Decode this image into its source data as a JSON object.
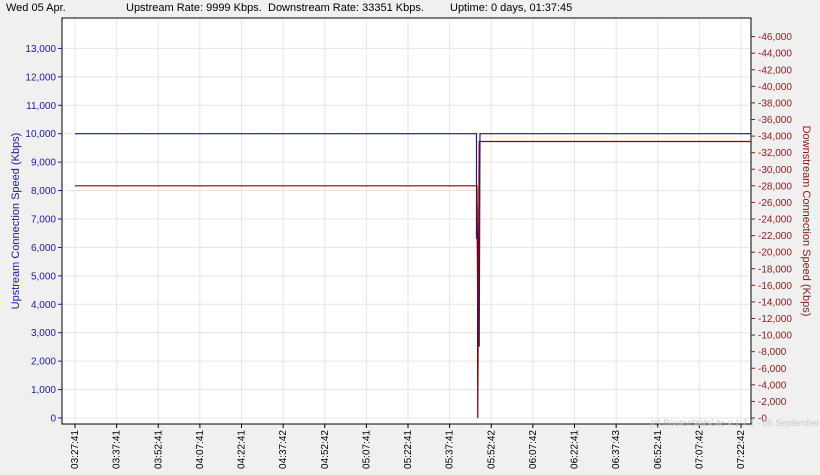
{
  "status": {
    "date": "Wed 05 Apr.",
    "upstream": "Upstream Rate: 9999 Kbps.",
    "downstream": "Downstream Rate: 33351 Kbps.",
    "uptime": "Uptime: 0 days, 01:37:45"
  },
  "watermark": "(c) RouterStatsLite v 1.7.1 - 05 September",
  "chart_data": {
    "type": "line",
    "ylabel_left": "Upstream Connection Speed (Kbps)",
    "ylabel_right": "Downstream Connection Speed (Kbps)",
    "ylim_left": [
      0,
      14000
    ],
    "ylim_right": [
      0,
      48000
    ],
    "yticks_left": [
      0,
      1000,
      2000,
      3000,
      4000,
      5000,
      6000,
      7000,
      8000,
      9000,
      10000,
      11000,
      12000,
      13000
    ],
    "yticks_right": [
      0,
      2000,
      4000,
      6000,
      8000,
      10000,
      12000,
      14000,
      16000,
      18000,
      20000,
      22000,
      24000,
      26000,
      28000,
      30000,
      32000,
      34000,
      36000,
      38000,
      40000,
      42000,
      44000,
      46000
    ],
    "xticks": [
      "03:27:41",
      "03:37:41",
      "03:52:41",
      "04:07:41",
      "04:22:41",
      "04:37:42",
      "04:52:42",
      "05:07:41",
      "05:22:41",
      "05:37:41",
      "05:52:42",
      "06:07:42",
      "06:22:41",
      "06:37:43",
      "06:52:41",
      "07:07:42",
      "07:22:42"
    ],
    "x_range_minutes": [
      0,
      245
    ],
    "grid": true,
    "colors": {
      "upstream": "#1a1a8c",
      "downstream": "#8b0000",
      "grid": "#e4e4e4",
      "left_axis": "#1a1aa0",
      "right_axis": "#8b1a1a"
    },
    "series": [
      {
        "axis": "left",
        "points": [
          [
            0,
            9999
          ],
          [
            145.5,
            9999
          ],
          [
            145.5,
            7500
          ],
          [
            145.5,
            6300
          ],
          [
            145.7,
            7500
          ],
          [
            146,
            5000
          ],
          [
            146.5,
            2500
          ],
          [
            146.8,
            9999
          ],
          [
            245,
            9999
          ]
        ]
      },
      {
        "axis": "right",
        "points": [
          [
            0,
            28000
          ],
          [
            145.7,
            28000
          ],
          [
            145.9,
            15000
          ],
          [
            145.9,
            7000
          ],
          [
            146,
            0
          ],
          [
            146.2,
            17000
          ],
          [
            146.5,
            33351
          ],
          [
            245,
            33351
          ]
        ]
      }
    ]
  }
}
